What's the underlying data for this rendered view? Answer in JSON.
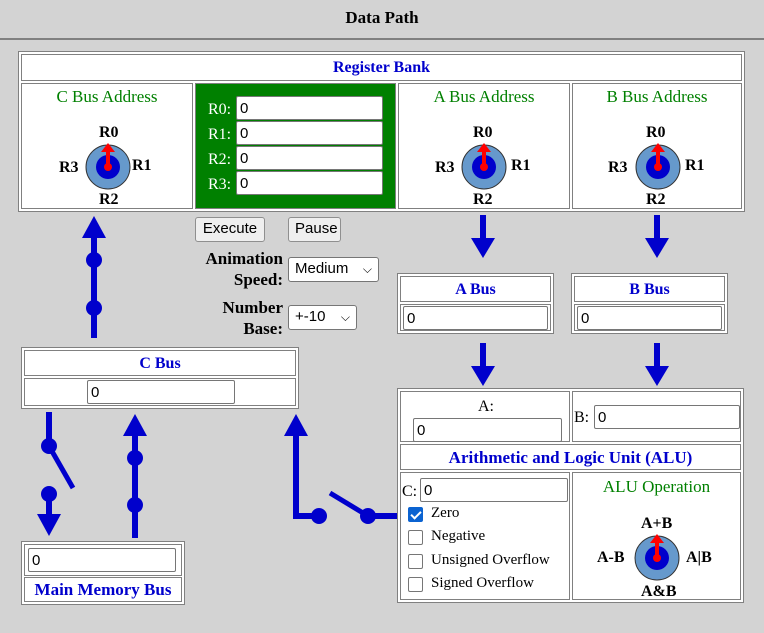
{
  "title": "Data Path",
  "register_bank": {
    "title": "Register Bank",
    "registers": [
      {
        "label": "R0:",
        "value": "0"
      },
      {
        "label": "R1:",
        "value": "0"
      },
      {
        "label": "R2:",
        "value": "0"
      },
      {
        "label": "R3:",
        "value": "0"
      }
    ],
    "c_address": {
      "title": "C Bus Address",
      "top": "R0",
      "right": "R1",
      "bottom": "R2",
      "left": "R3"
    },
    "a_address": {
      "title": "A Bus Address",
      "top": "R0",
      "right": "R1",
      "bottom": "R2",
      "left": "R3"
    },
    "b_address": {
      "title": "B Bus Address",
      "top": "R0",
      "right": "R1",
      "bottom": "R2",
      "left": "R3"
    }
  },
  "controls": {
    "execute": "Execute",
    "pause": "Pause",
    "speed_label_1": "Animation",
    "speed_label_2": "Speed:",
    "speed_value": "Medium",
    "base_label_1": "Number",
    "base_label_2": "Base:",
    "base_value": "+-10"
  },
  "a_bus": {
    "title": "A Bus",
    "value": "0"
  },
  "b_bus": {
    "title": "B Bus",
    "value": "0"
  },
  "c_bus": {
    "title": "C Bus",
    "value": "0"
  },
  "memory_bus": {
    "title": "Main Memory Bus",
    "value": "0"
  },
  "alu": {
    "a_label": "A:",
    "a_value": "0",
    "b_label": "B:",
    "b_value": "0",
    "title": "Arithmetic and Logic Unit (ALU)",
    "c_label": "C:",
    "c_value": "0",
    "flags": [
      {
        "label": "Zero",
        "checked": true
      },
      {
        "label": "Negative",
        "checked": false
      },
      {
        "label": "Unsigned Overflow",
        "checked": false
      },
      {
        "label": "Signed Overflow",
        "checked": false
      }
    ],
    "operation": {
      "title": "ALU Operation",
      "top": "A+B",
      "right": "A|B",
      "bottom": "A&B",
      "left": "A-B"
    }
  },
  "colors": {
    "wire": "#0000cc",
    "register_bg": "#008000",
    "knob_outer": "#6699cc",
    "knob_inner": "#0000cc",
    "pointer": "#ff0000"
  }
}
